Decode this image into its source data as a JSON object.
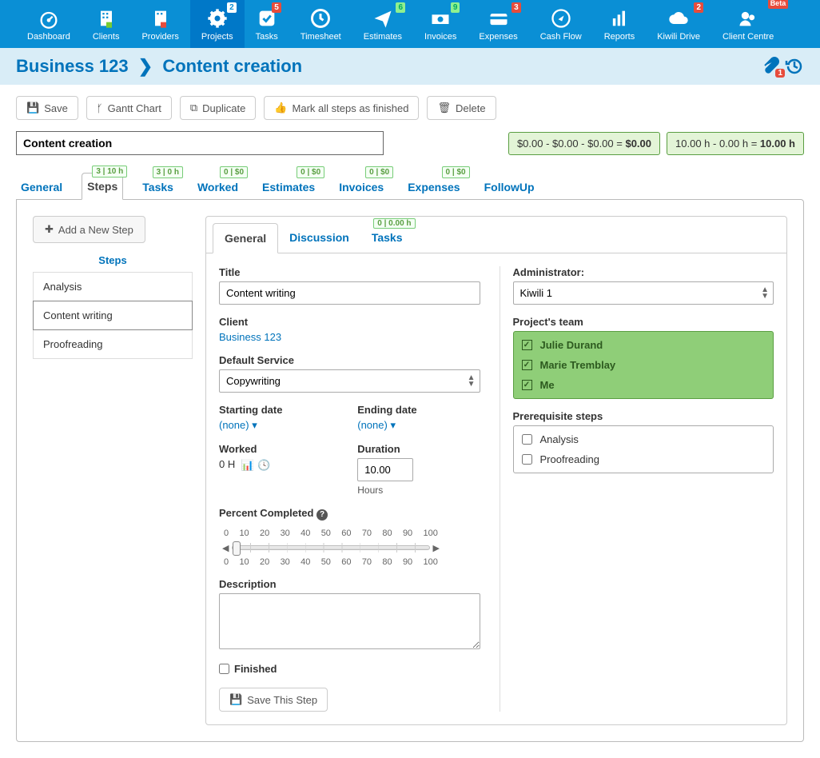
{
  "nav": [
    {
      "label": "Dashboard",
      "icon": "gauge",
      "badge": null
    },
    {
      "label": "Clients",
      "icon": "building",
      "badge": null
    },
    {
      "label": "Providers",
      "icon": "building2",
      "badge": null
    },
    {
      "label": "Projects",
      "icon": "gear",
      "badge": "2",
      "active": true
    },
    {
      "label": "Tasks",
      "icon": "check",
      "badge": "5",
      "badgeClass": "red"
    },
    {
      "label": "Timesheet",
      "icon": "clock",
      "badge": null
    },
    {
      "label": "Estimates",
      "icon": "paperplane",
      "badge": "6",
      "badgeClass": "green"
    },
    {
      "label": "Invoices",
      "icon": "money",
      "badge": "9",
      "badgeClass": "green"
    },
    {
      "label": "Expenses",
      "icon": "card",
      "badge": "3",
      "badgeClass": "red"
    },
    {
      "label": "Cash Flow",
      "icon": "compass",
      "badge": null
    },
    {
      "label": "Reports",
      "icon": "bars",
      "badge": null
    },
    {
      "label": "Kiwili Drive",
      "icon": "cloud",
      "badge": "2",
      "badgeClass": "red"
    },
    {
      "label": "Client Centre",
      "icon": "people",
      "badge": "Beta",
      "badgeClass": "beta"
    }
  ],
  "crumb": {
    "business": "Business 123",
    "page": "Content creation",
    "attach_count": "1"
  },
  "buttons": {
    "save": "Save",
    "gantt": "Gantt Chart",
    "duplicate": "Duplicate",
    "markfinished": "Mark all steps as finished",
    "delete": "Delete"
  },
  "title_value": "Content creation",
  "summary": {
    "money": "$0.00 - $0.00 - $0.00 = ",
    "money_bold": "$0.00",
    "hours": "10.00 h - 0.00 h = ",
    "hours_bold": "10.00 h"
  },
  "tabs": [
    {
      "label": "General"
    },
    {
      "label": "Steps",
      "badge": "3 | 10 h",
      "active": true
    },
    {
      "label": "Tasks",
      "badge": "3 | 0 h"
    },
    {
      "label": "Worked",
      "badge": "0 | $0"
    },
    {
      "label": "Estimates",
      "badge": "0 | $0"
    },
    {
      "label": "Invoices",
      "badge": "0 | $0"
    },
    {
      "label": "Expenses",
      "badge": "0 | $0"
    },
    {
      "label": "FollowUp"
    }
  ],
  "left": {
    "add": "Add a New Step",
    "header": "Steps",
    "items": [
      {
        "label": "Analysis"
      },
      {
        "label": "Content writing",
        "active": true
      },
      {
        "label": "Proofreading"
      }
    ]
  },
  "itabs": [
    {
      "label": "General",
      "active": true
    },
    {
      "label": "Discussion"
    },
    {
      "label": "Tasks",
      "badge": "0 | 0.00 h"
    }
  ],
  "form": {
    "title_label": "Title",
    "title_value": "Content writing",
    "client_label": "Client",
    "client_value": "Business 123",
    "service_label": "Default Service",
    "service_value": "Copywriting",
    "start_label": "Starting date",
    "start_value": "(none)",
    "end_label": "Ending date",
    "end_value": "(none)",
    "worked_label": "Worked",
    "worked_value": "0 H",
    "duration_label": "Duration",
    "duration_value": "10.00",
    "duration_unit": "Hours",
    "percent_label": "Percent Completed",
    "desc_label": "Description",
    "finished_label": "Finished",
    "savebtn": "Save This Step",
    "admin_label": "Administrator:",
    "admin_value": "Kiwili 1",
    "team_label": "Project's team",
    "team": [
      "Julie Durand",
      "Marie Tremblay",
      "Me"
    ],
    "prereq_label": "Prerequisite steps",
    "prereq": [
      "Analysis",
      "Proofreading"
    ],
    "slider_ticks": [
      "0",
      "10",
      "20",
      "30",
      "40",
      "50",
      "60",
      "70",
      "80",
      "90",
      "100"
    ]
  }
}
